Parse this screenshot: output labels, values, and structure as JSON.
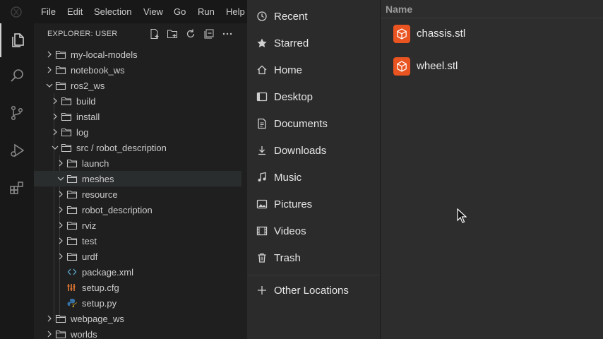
{
  "vscode": {
    "menu": [
      "File",
      "Edit",
      "Selection",
      "View",
      "Go",
      "Run",
      "Help"
    ],
    "activity_bar": [
      {
        "icon": "files-icon",
        "active": true
      },
      {
        "icon": "search-icon",
        "active": false
      },
      {
        "icon": "source-control-icon",
        "active": false
      },
      {
        "icon": "run-debug-icon",
        "active": false
      },
      {
        "icon": "extensions-icon",
        "active": false
      }
    ],
    "explorer": {
      "title": "EXPLORER: USER",
      "actions": [
        "new-file-icon",
        "new-folder-icon",
        "refresh-icon",
        "collapse-all-icon",
        "more-icon"
      ],
      "tree": [
        {
          "label": "my-local-models",
          "type": "folder",
          "expanded": false,
          "depth": 0
        },
        {
          "label": "notebook_ws",
          "type": "folder",
          "expanded": false,
          "depth": 0
        },
        {
          "label": "ros2_ws",
          "type": "folder",
          "expanded": true,
          "depth": 0
        },
        {
          "label": "build",
          "type": "folder",
          "expanded": false,
          "depth": 1
        },
        {
          "label": "install",
          "type": "folder",
          "expanded": false,
          "depth": 1
        },
        {
          "label": "log",
          "type": "folder",
          "expanded": false,
          "depth": 1
        },
        {
          "label": "src / robot_description",
          "type": "folder",
          "expanded": true,
          "depth": 1
        },
        {
          "label": "launch",
          "type": "folder",
          "expanded": false,
          "depth": 2
        },
        {
          "label": "meshes",
          "type": "folder",
          "expanded": true,
          "depth": 2,
          "selected": true
        },
        {
          "label": "resource",
          "type": "folder",
          "expanded": false,
          "depth": 2
        },
        {
          "label": "robot_description",
          "type": "folder",
          "expanded": false,
          "depth": 2
        },
        {
          "label": "rviz",
          "type": "folder",
          "expanded": false,
          "depth": 2
        },
        {
          "label": "test",
          "type": "folder",
          "expanded": false,
          "depth": 2
        },
        {
          "label": "urdf",
          "type": "folder",
          "expanded": false,
          "depth": 2
        },
        {
          "label": "package.xml",
          "type": "xml",
          "depth": 2
        },
        {
          "label": "setup.cfg",
          "type": "cfg",
          "depth": 2
        },
        {
          "label": "setup.py",
          "type": "py",
          "depth": 2
        },
        {
          "label": "webpage_ws",
          "type": "folder",
          "expanded": false,
          "depth": 0
        },
        {
          "label": "worlds",
          "type": "folder",
          "expanded": false,
          "depth": 0
        }
      ]
    }
  },
  "files": {
    "places": [
      {
        "label": "Recent",
        "icon": "clock-icon"
      },
      {
        "label": "Starred",
        "icon": "star-icon"
      },
      {
        "label": "Home",
        "icon": "home-icon"
      },
      {
        "label": "Desktop",
        "icon": "desktop-icon"
      },
      {
        "label": "Documents",
        "icon": "documents-icon"
      },
      {
        "label": "Downloads",
        "icon": "download-icon"
      },
      {
        "label": "Music",
        "icon": "music-icon"
      },
      {
        "label": "Pictures",
        "icon": "pictures-icon"
      },
      {
        "label": "Videos",
        "icon": "videos-icon"
      },
      {
        "label": "Trash",
        "icon": "trash-icon"
      }
    ],
    "other_locations": {
      "label": "Other Locations",
      "icon": "plus-icon"
    },
    "column_header": "Name",
    "items": [
      {
        "name": "chassis.stl",
        "icon": "3d-model-file-icon"
      },
      {
        "name": "wheel.stl",
        "icon": "3d-model-file-icon"
      }
    ]
  },
  "colors": {
    "vscode_bg": "#181818",
    "sidebar_bg": "#1f1f1f",
    "files_sidebar_bg": "#2b2b2b",
    "files_main_bg": "#2d2d2d",
    "file_icon_accent": "#e95420",
    "folder_icon": "#c5c5c5"
  }
}
